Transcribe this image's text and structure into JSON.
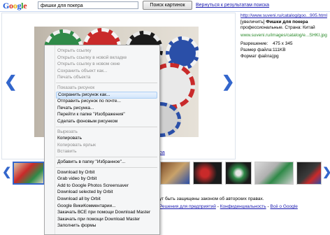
{
  "header": {
    "logo_text": "Google",
    "search_value": "фишки для покера",
    "search_button": "Поиск картинок",
    "back_link": "Вернуться к результатам поиска"
  },
  "viewer": {
    "caption_fragment": "ра",
    "arrow_left": "❮",
    "arrow_right": "❯"
  },
  "info": {
    "url1": "http://www.suveni.ru/catalog/goo...905.html",
    "desc_prefix": "[увеличить]",
    "desc_title": "Фишки для покера",
    "desc_rest": "профессиональные. Страна: Китай",
    "url2": "www.suveni.ru/images/catalog/e...SHKI.jpg",
    "rows": [
      {
        "label": "Разрешение:",
        "value": "475 x 345"
      },
      {
        "label": "Размер файла:",
        "value": "111KB"
      },
      {
        "label": "Формат файла:",
        "value": "jpg"
      }
    ]
  },
  "strip": {
    "arrow_left": "❮",
    "arrow_right": "❯"
  },
  "footer": {
    "line1": "ут быть защищены законом об авторских правах.",
    "links": [
      "Решения для предприятий",
      "Конфиденциальность",
      "Всё о Google"
    ],
    "dash": "-"
  },
  "context_menu": {
    "items": [
      {
        "label": "Открыть ссылку",
        "disabled": true
      },
      {
        "label": "Открыть ссылку в новой вкладке",
        "disabled": true
      },
      {
        "label": "Открыть ссылку в новом окне",
        "disabled": true
      },
      {
        "label": "Сохранить объект как...",
        "disabled": true
      },
      {
        "label": "Печать объекта",
        "disabled": true
      },
      {
        "sep": true
      },
      {
        "label": "Показать рисунок",
        "disabled": true
      },
      {
        "label": "Сохранить рисунок как...",
        "highlighted": true
      },
      {
        "label": "Отправить рисунок по почте..."
      },
      {
        "label": "Печать рисунка..."
      },
      {
        "label": "Перейти к папке \"Изображения\""
      },
      {
        "label": "Сделать фоновым рисунком"
      },
      {
        "sep": true
      },
      {
        "label": "Вырезать",
        "disabled": true
      },
      {
        "label": "Копировать"
      },
      {
        "label": "Копировать ярлык",
        "disabled": true
      },
      {
        "label": "Вставить",
        "disabled": true
      },
      {
        "sep": true
      },
      {
        "label": "Добавить в папку \"Избранное\"..."
      },
      {
        "sep": true
      },
      {
        "label": "Download by Orbit"
      },
      {
        "label": "Grab video by Orbit"
      },
      {
        "label": "Add to Google Photos Screensaver"
      },
      {
        "label": "Download selected by Orbit"
      },
      {
        "label": "Download all by Orbit"
      },
      {
        "label": "Google ВикиКомментарии..."
      },
      {
        "label": "Закачать ВСЕ при помощи Download Master"
      },
      {
        "label": "Закачать при помощи Download Master"
      },
      {
        "label": "Заполнить формы"
      }
    ]
  },
  "colors": {
    "link": "#1a1ab0",
    "url_green": "#2a8a2a",
    "accent_blue": "#3366cc",
    "menu_bg": "#f5f6f7",
    "menu_highlight": "#d3e6fb"
  }
}
